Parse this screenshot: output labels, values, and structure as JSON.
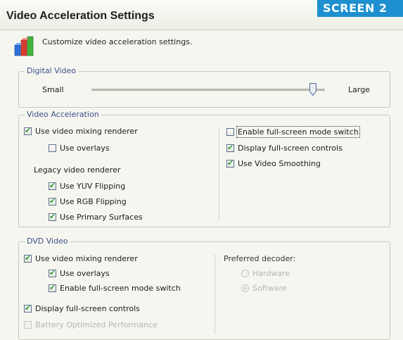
{
  "window": {
    "title": "Video Acceleration Settings",
    "badge": "SCREEN 2"
  },
  "header": {
    "description": "Customize video acceleration settings.",
    "icon": "bar-chart-icon"
  },
  "digital_video": {
    "legend": "Digital Video",
    "slider_min_label": "Small",
    "slider_max_label": "Large",
    "slider_value": 0.95
  },
  "video_acceleration": {
    "legend": "Video Acceleration",
    "use_vmr": {
      "label": "Use video mixing renderer",
      "checked": true
    },
    "use_overlays": {
      "label": "Use overlays",
      "checked": false
    },
    "legacy_heading": "Legacy video renderer",
    "use_yuv": {
      "label": "Use YUV Flipping",
      "checked": true
    },
    "use_rgb": {
      "label": "Use RGB Flipping",
      "checked": true
    },
    "use_primary": {
      "label": "Use Primary Surfaces",
      "checked": true
    },
    "enable_fullscreen_switch": {
      "label": "Enable full-screen mode switch",
      "checked": false
    },
    "display_fullscreen_controls": {
      "label": "Display full-screen controls",
      "checked": true
    },
    "use_smoothing": {
      "label": "Use Video Smoothing",
      "checked": true
    }
  },
  "dvd_video": {
    "legend": "DVD Video",
    "use_vmr": {
      "label": "Use video mixing renderer",
      "checked": true
    },
    "use_overlays": {
      "label": "Use overlays",
      "checked": true
    },
    "enable_fullscreen_switch": {
      "label": "Enable full-screen mode switch",
      "checked": true
    },
    "display_fullscreen_controls": {
      "label": "Display full-screen controls",
      "checked": true
    },
    "battery_optimized": {
      "label": "Battery Optimized Performance",
      "checked": false,
      "disabled": true
    },
    "preferred_decoder": {
      "heading": "Preferred decoder:",
      "options": [
        "Hardware",
        "Software"
      ],
      "selected": "Software"
    }
  }
}
